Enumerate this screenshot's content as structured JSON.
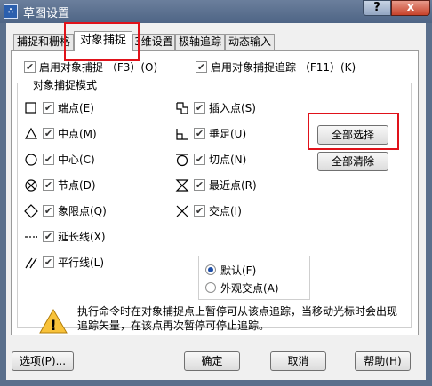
{
  "window": {
    "title": "草图设置",
    "help_glyph": "?",
    "close_glyph": "x",
    "icon_text": "∴"
  },
  "tabs": [
    {
      "label": "捕捉和栅格"
    },
    {
      "label": "对象捕捉"
    },
    {
      "label": "3维设置"
    },
    {
      "label": "极轴追踪"
    },
    {
      "label": "动态输入"
    }
  ],
  "options": {
    "enable_snap": {
      "label": "启用对象捕捉 （F3）(O)",
      "checked": true
    },
    "enable_tracking": {
      "label": "启用对象捕捉追踪 （F11）(K)",
      "checked": true
    }
  },
  "group_title": "对象捕捉模式",
  "snap_modes_left": [
    {
      "label": "端点(E)",
      "icon": "square-icon",
      "checked": true
    },
    {
      "label": "中点(M)",
      "icon": "triangle-icon",
      "checked": true
    },
    {
      "label": "中心(C)",
      "icon": "circle-icon",
      "checked": true
    },
    {
      "label": "节点(D)",
      "icon": "node-icon",
      "checked": true
    },
    {
      "label": "象限点(Q)",
      "icon": "diamond-icon",
      "checked": true
    },
    {
      "label": "延长线(X)",
      "icon": "extension-icon",
      "checked": true
    },
    {
      "label": "平行线(L)",
      "icon": "parallel-icon",
      "checked": true
    }
  ],
  "snap_modes_right": [
    {
      "label": "插入点(S)",
      "icon": "insert-icon",
      "checked": true
    },
    {
      "label": "垂足(U)",
      "icon": "perpendicular-icon",
      "checked": true
    },
    {
      "label": "切点(N)",
      "icon": "tangent-icon",
      "checked": true
    },
    {
      "label": "最近点(R)",
      "icon": "nearest-icon",
      "checked": true
    },
    {
      "label": "交点(I)",
      "icon": "intersection-icon",
      "checked": true
    }
  ],
  "buttons": {
    "select_all": "全部选择",
    "clear_all": "全部清除",
    "options": "选项(P)...",
    "ok": "确定",
    "cancel": "取消",
    "help": "帮助(H)"
  },
  "marker_mode": {
    "default_label": "默认(F)",
    "default_selected": true,
    "apparent_label": "外观交点(A)",
    "apparent_selected": false
  },
  "info_text": "执行命令时在对象捕捉点上暂停可从该点追踪，当移动光标时会出现追踪矢量，在该点再次暂停可停止追踪。",
  "check_glyph": "✔",
  "warning_glyph": "!"
}
